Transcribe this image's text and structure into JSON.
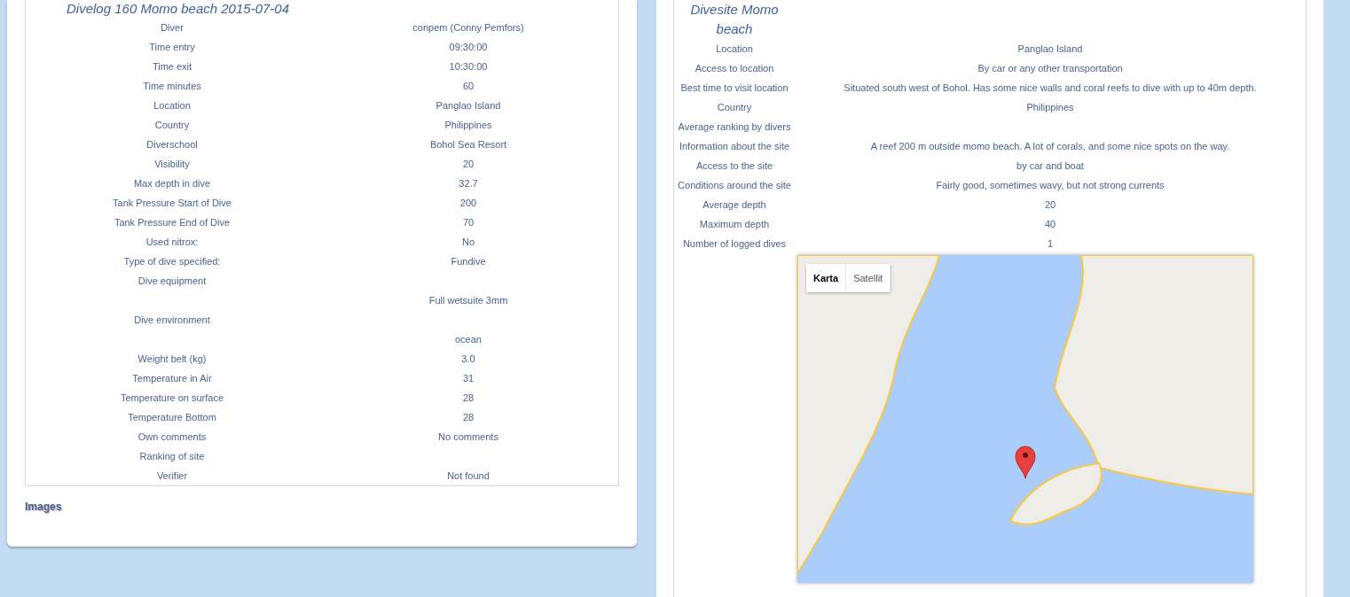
{
  "divelog": {
    "title": "Divelog 160 Momo beach 2015-07-04",
    "rows": [
      {
        "label": "Diver",
        "value": "conpem (Conny Pemfors)"
      },
      {
        "label": "Time entry",
        "value": "09:30:00"
      },
      {
        "label": "Time exit",
        "value": "10:30:00"
      },
      {
        "label": "Time minutes",
        "value": "60"
      },
      {
        "label": "Location",
        "value": "Panglao Island"
      },
      {
        "label": "Country",
        "value": "Philippines"
      },
      {
        "label": "Diverschool",
        "value": "Bohol Sea Resort"
      },
      {
        "label": "Visibility",
        "value": "20"
      },
      {
        "label": "Max depth in dive",
        "value": "32.7"
      },
      {
        "label": "Tank Pressure Start of Dive",
        "value": "200"
      },
      {
        "label": "Tank Pressure End of Dive",
        "value": "70"
      },
      {
        "label": "Used nitrox:",
        "value": "No"
      },
      {
        "label": "Type of dive specified:",
        "value": "Fundive"
      },
      {
        "label": "Dive equipment"
      },
      {
        "value": "Full wetsuite 3mm"
      },
      {
        "label": "Dive environment"
      },
      {
        "value": "ocean"
      },
      {
        "label": "Weight belt (kg)",
        "value": "3.0"
      },
      {
        "label": "Temperature in Air",
        "value": "31"
      },
      {
        "label": "Temperature on surface",
        "value": "28"
      },
      {
        "label": "Temperature Bottom",
        "value": "28"
      },
      {
        "label": "Own comments",
        "value": "No comments"
      },
      {
        "label": "Ranking of site"
      },
      {
        "label": "Verifier",
        "value": "Not found"
      }
    ],
    "images_heading": "Images"
  },
  "divesite": {
    "title": "Divesite Momo beach",
    "rows": [
      {
        "label": "Location",
        "value": "Panglao Island"
      },
      {
        "label": "Access to location",
        "value": "By car or any other transportation"
      },
      {
        "label": "Best time to visit location",
        "value": "Situated south west of Bohol. Has some nice walls and coral reefs to dive with up to 40m depth."
      },
      {
        "label": "Country",
        "value": "Philippines"
      },
      {
        "label": "Average ranking by divers"
      },
      {
        "label": "Information about the site",
        "value": "A reef 200 m outside momo beach. A lot of corals, and some nice spots on the way."
      },
      {
        "label": "Access to the site",
        "value": "by car and boat"
      },
      {
        "label": "Conditions around the site",
        "value": "Fairly good, sometimes wavy, but not strong currents"
      },
      {
        "label": "Average depth",
        "value": "20"
      },
      {
        "label": "Maximum depth",
        "value": "40"
      },
      {
        "label": "Number of logged dives",
        "value": "1"
      }
    ],
    "map": {
      "types": [
        {
          "label": "Karta",
          "selected": true
        },
        {
          "label": "Satellit",
          "selected": false
        }
      ]
    }
  }
}
